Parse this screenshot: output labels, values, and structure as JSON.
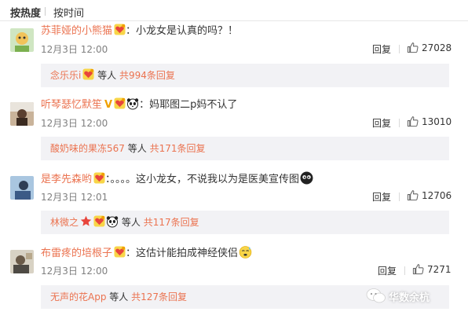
{
  "sort": {
    "hot": "按热度",
    "time": "按时间"
  },
  "comments": [
    {
      "user": "苏菲娅的小熊猫",
      "text": "：小龙女是认真的吗？！",
      "time": "12月3日 12:00",
      "reply": "回复",
      "likes": "27028",
      "sub_user": "念乐乐i",
      "sub_mid": "等人",
      "sub_count": "共994条回复"
    },
    {
      "user": "听琴瑟忆默笙",
      "vbadge": "V",
      "text": "：妈耶图二p妈不认了",
      "time": "12月3日 12:00",
      "reply": "回复",
      "likes": "13010",
      "sub_user": "酸奶味的果冻567",
      "sub_mid": "等人",
      "sub_count": "共171条回复"
    },
    {
      "user": "是李先森哟",
      "text": "：。。。。这小龙女，不说我以为是医美宣传图",
      "time": "12月3日 12:01",
      "reply": "回复",
      "likes": "12706",
      "sub_user": "林微之",
      "sub_mid": "等人",
      "sub_count": "共117条回复"
    },
    {
      "user": "布雷疼的培根子",
      "text": "：这估计能拍成神经侠侣",
      "time": "12月3日 12:00",
      "reply": "回复",
      "likes": "7271",
      "sub_user": "无声的花App",
      "sub_mid": "等人",
      "sub_count": "共127条回复"
    }
  ],
  "watermark": "华数余杭",
  "colors": {
    "username": "#eb7350",
    "meta": "#808080",
    "subbar_bg": "#f2f2f5"
  },
  "icons": [
    "heart-badge-icon",
    "panda-icon",
    "black-face-emoji-icon",
    "sweat-emoji-icon",
    "star-badge-icon",
    "thumb-up-icon"
  ]
}
